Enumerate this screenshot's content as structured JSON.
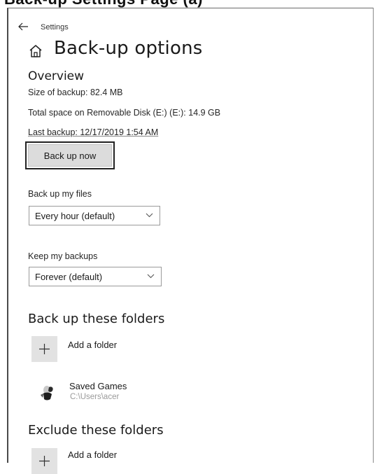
{
  "top_strip": {
    "cut_text": "Back-up Settings Page (a)"
  },
  "nav": {
    "back_icon": "back-arrow-icon",
    "settings_caption": "Settings"
  },
  "header": {
    "home_icon": "home-icon",
    "title": "Back-up options"
  },
  "overview": {
    "heading": "Overview",
    "size_of_backup": "Size of backup: 82.4 MB",
    "total_space": "Total space on Removable Disk (E:) (E:): 14.9 GB",
    "last_backup": "Last backup: 12/17/2019 1:54 AM",
    "backup_now_label": "Back up now"
  },
  "backup_frequency": {
    "label": "Back up my files",
    "selected": "Every hour (default)"
  },
  "retention": {
    "label": "Keep my backups",
    "selected": "Forever (default)"
  },
  "include_folders": {
    "heading": "Back up these folders",
    "add_label": "Add a folder",
    "items": [
      {
        "name": "Saved Games",
        "path": "C:\\Users\\acer",
        "icon": "saved-games-folder-icon"
      }
    ]
  },
  "exclude_folders": {
    "heading": "Exclude these folders",
    "add_label": "Add a folder"
  },
  "colors": {
    "button_fill": "#dcdcdc",
    "add_tile_fill": "#e2e2e2",
    "secondary_text": "#9a9a9a"
  }
}
